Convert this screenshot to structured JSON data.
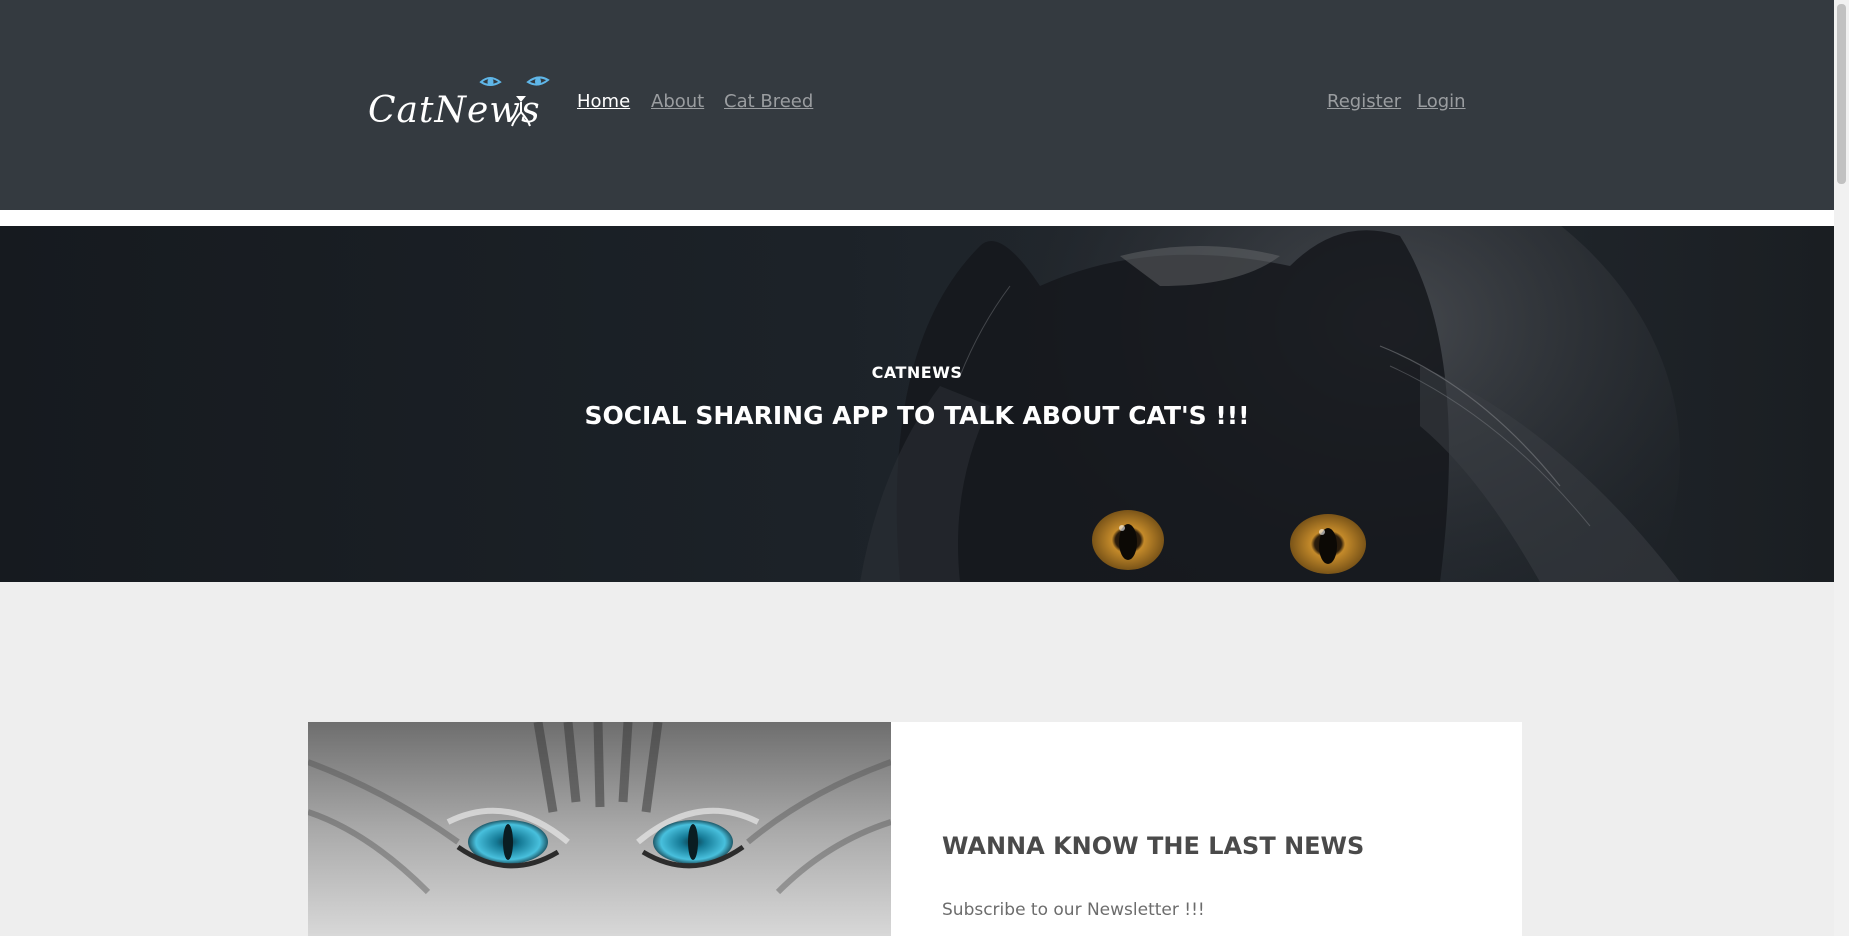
{
  "brand": {
    "name": "CatNews"
  },
  "nav": {
    "links": [
      {
        "label": "Home",
        "active": true
      },
      {
        "label": "About",
        "active": false
      },
      {
        "label": "Cat Breed",
        "active": false
      }
    ],
    "auth": [
      {
        "label": "Register"
      },
      {
        "label": "Login"
      }
    ]
  },
  "hero": {
    "kicker": "CATNEWS",
    "title": "SOCIAL SHARING APP TO TALK ABOUT CAT'S !!!"
  },
  "newsletter": {
    "title": "WANNA KNOW THE LAST NEWS",
    "subtitle": "Subscribe to our Newsletter !!!"
  },
  "colors": {
    "navbar": "#343a40",
    "page_background": "#eeeeee",
    "logo_eye_accent": "#5fb6e8",
    "hero_eye_accent": "#d8a030",
    "news_eye_accent": "#3fb6d6"
  }
}
